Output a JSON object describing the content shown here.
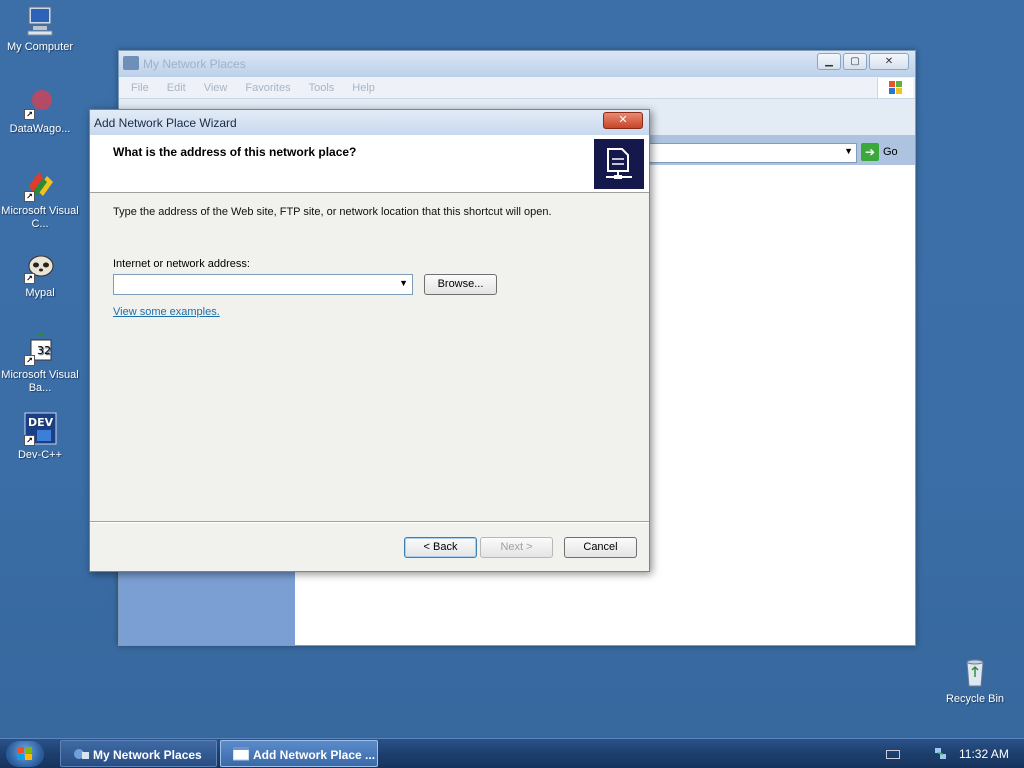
{
  "desktop": {
    "icons": [
      {
        "label": "My Computer",
        "icon": "computer-icon"
      },
      {
        "label": "DataWago...",
        "icon": "datawagon-icon"
      },
      {
        "label": "Microsoft Visual C...",
        "icon": "visual-cpp-icon"
      },
      {
        "label": "Mypal",
        "icon": "mypal-icon"
      },
      {
        "label": "Microsoft Visual Ba...",
        "icon": "visual-basic-icon"
      },
      {
        "label": "Dev-C++",
        "icon": "dev-cpp-icon"
      }
    ],
    "recycle_bin": {
      "label": "Recycle Bin",
      "icon": "recycle-bin-icon"
    }
  },
  "explorer": {
    "title": "My Network Places",
    "menu": [
      "File",
      "Edit",
      "View",
      "Favorites",
      "Tools",
      "Help"
    ],
    "go_label": "Go"
  },
  "wizard": {
    "title": "Add Network Place Wizard",
    "close_label": "✕",
    "heading": "What is the address of this network place?",
    "instruction": "Type the address of the Web site, FTP site, or network location that this shortcut will open.",
    "address_label": "Internet or network address:",
    "address_value": "",
    "browse_label": "Browse...",
    "examples_link": "View some examples.",
    "back_label": "< Back",
    "next_label": "Next >",
    "cancel_label": "Cancel"
  },
  "taskbar": {
    "tasks": [
      {
        "label": "My Network Places",
        "active": false
      },
      {
        "label": "Add Network Place ...",
        "active": true
      }
    ],
    "clock": "11:32 AM"
  },
  "colors": {
    "desktop": "#3a6ea5",
    "link": "#1d6fa8",
    "taskbar": "#1d3f6e"
  }
}
